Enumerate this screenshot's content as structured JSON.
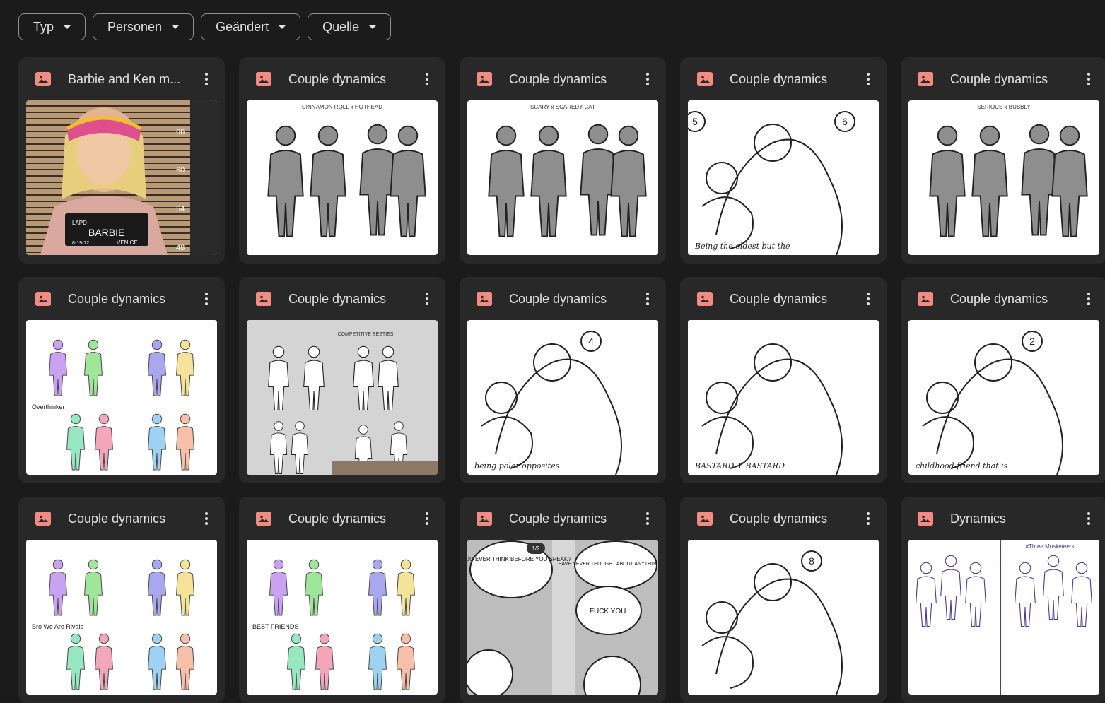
{
  "filters": [
    {
      "label": "Typ"
    },
    {
      "label": "Personen"
    },
    {
      "label": "Geändert"
    },
    {
      "label": "Quelle"
    }
  ],
  "cards": [
    {
      "title": "Barbie and Ken m...",
      "kind": "photo",
      "photo_text": {
        "agency": "LAPD",
        "name": "BARBIE",
        "date": "8-19-72",
        "city": "VENICE",
        "heights": [
          "66",
          "60",
          "54",
          "48"
        ]
      }
    },
    {
      "title": "Couple dynamics",
      "kind": "grey-figures",
      "caption": "CINNAMON ROLL    x    HOTHEAD"
    },
    {
      "title": "Couple dynamics",
      "kind": "grey-figures",
      "caption": "SCARY    x    SCAREDY CAT"
    },
    {
      "title": "Couple dynamics",
      "kind": "sketch",
      "numbers": [
        "5",
        "6"
      ],
      "caption": "Being the oldest but the"
    },
    {
      "title": "Couple dynamics",
      "kind": "grey-figures",
      "caption": "SERIOUS  x  BUBBLY"
    },
    {
      "title": "Couple dynamics",
      "kind": "color-pastel",
      "caption": "Overthinker"
    },
    {
      "title": "Couple dynamics",
      "kind": "grey-bg",
      "caption": "COMPETITIVE BESTIES"
    },
    {
      "title": "Couple dynamics",
      "kind": "sketch",
      "numbers": [
        "4"
      ],
      "caption": "being polar opposites"
    },
    {
      "title": "Couple dynamics",
      "kind": "sketch",
      "numbers": [],
      "caption": "BASTARD + BASTARD"
    },
    {
      "title": "Couple dynamics",
      "kind": "sketch",
      "numbers": [
        "2"
      ],
      "caption": "childhood friend that is"
    },
    {
      "title": "Couple dynamics",
      "kind": "color-pastel",
      "caption": "Bro We Are Rivals"
    },
    {
      "title": "Couple dynamics",
      "kind": "color-pastel",
      "caption": "BEST FRIENDS"
    },
    {
      "title": "Couple dynamics",
      "kind": "comic",
      "bubbles": [
        "DO YOU EVER THINK BEFORE YOU SPEAK?",
        "I HAVE NEVER THOUGHT ABOUT ANYTHING EVER.",
        "FUCK YOU."
      ],
      "counter": "1/2"
    },
    {
      "title": "Couple dynamics",
      "kind": "sketch",
      "numbers": [
        "8"
      ],
      "caption": ""
    },
    {
      "title": "Dynamics",
      "kind": "purple",
      "caption": "#Three Musketeers"
    }
  ]
}
